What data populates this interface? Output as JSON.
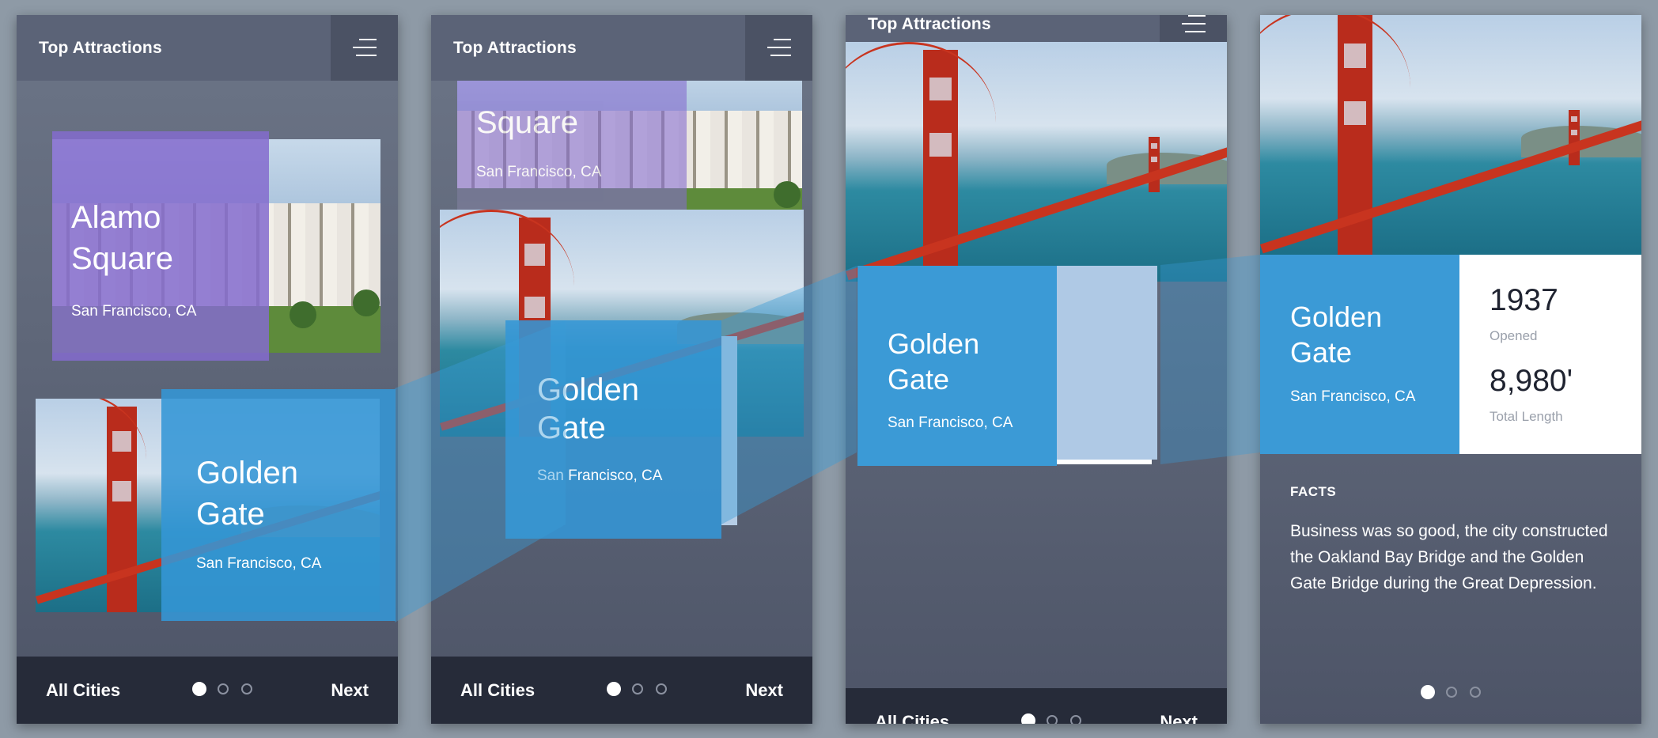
{
  "header": {
    "title": "Top Attractions",
    "menu_icon": "hamburger-menu-icon"
  },
  "footer": {
    "left_label": "All Cities",
    "right_label": "Next",
    "pages": 3,
    "active_page": 1
  },
  "attractions": {
    "alamo": {
      "name_line1": "Alamo",
      "name_line2": "Square",
      "location": "San Francisco, CA"
    },
    "golden": {
      "name_line1": "Golden",
      "name_line2": "Gate",
      "location": "San Francisco, CA"
    }
  },
  "details": {
    "stats": [
      {
        "value": "1937",
        "label": "Opened"
      },
      {
        "value": "8,980'",
        "label": "Total Length"
      }
    ],
    "facts_title": "FACTS",
    "facts_lines": [
      "Business was so good, the city constructed",
      "the Oakland Bay Bridge and the Golden",
      "Gate Bridge during the Great Depression."
    ]
  },
  "colors": {
    "accent_blue": "#3b9ad6",
    "purple": "#846bce",
    "footer_dark": "#262b39",
    "header": "#5b6377"
  }
}
